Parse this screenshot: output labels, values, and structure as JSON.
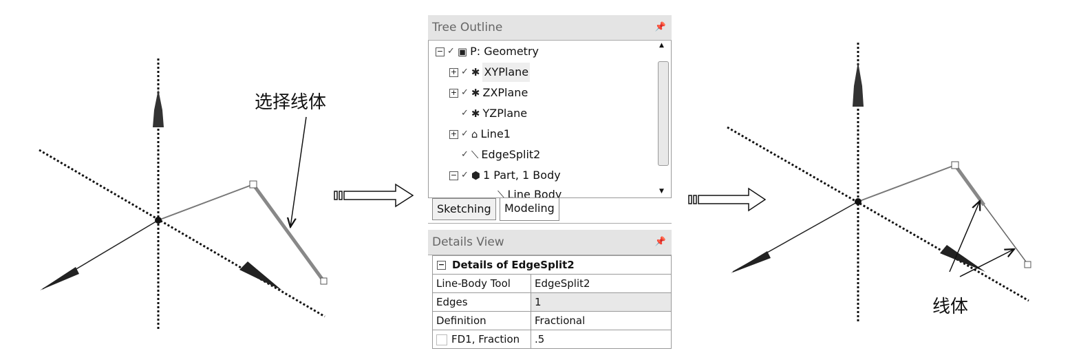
{
  "annotations": {
    "select_line_body": "选择线体",
    "line_body": "线体"
  },
  "tree_outline": {
    "title": "Tree Outline",
    "pin_icon": "pin-icon",
    "items": [
      {
        "label": "P: Geometry",
        "expander": "−",
        "icon": "geometry-icon"
      },
      {
        "label": "XYPlane",
        "expander": "+",
        "icon": "plane-icon",
        "selected": true
      },
      {
        "label": "ZXPlane",
        "expander": "+",
        "icon": "plane-icon"
      },
      {
        "label": "YZPlane",
        "expander": "",
        "icon": "plane-icon"
      },
      {
        "label": "Line1",
        "expander": "+",
        "icon": "sketch-line-icon"
      },
      {
        "label": "EdgeSplit2",
        "expander": "",
        "icon": "edge-split-icon"
      },
      {
        "label": "1 Part, 1 Body",
        "expander": "−",
        "icon": "part-icon"
      },
      {
        "label": "Line Body",
        "expander": "",
        "icon": "line-body-icon"
      }
    ],
    "tabs": [
      {
        "label": "Sketching"
      },
      {
        "label": "Modeling",
        "active": true
      }
    ]
  },
  "details_view": {
    "title": "Details View",
    "header": "Details of EdgeSplit2",
    "rows": [
      {
        "name": "Line-Body Tool",
        "value": "EdgeSplit2"
      },
      {
        "name": "Edges",
        "value": "1"
      },
      {
        "name": "Definition",
        "value": "Fractional"
      },
      {
        "name": "FD1,  Fraction",
        "value": ".5",
        "checkbox": true
      }
    ]
  }
}
